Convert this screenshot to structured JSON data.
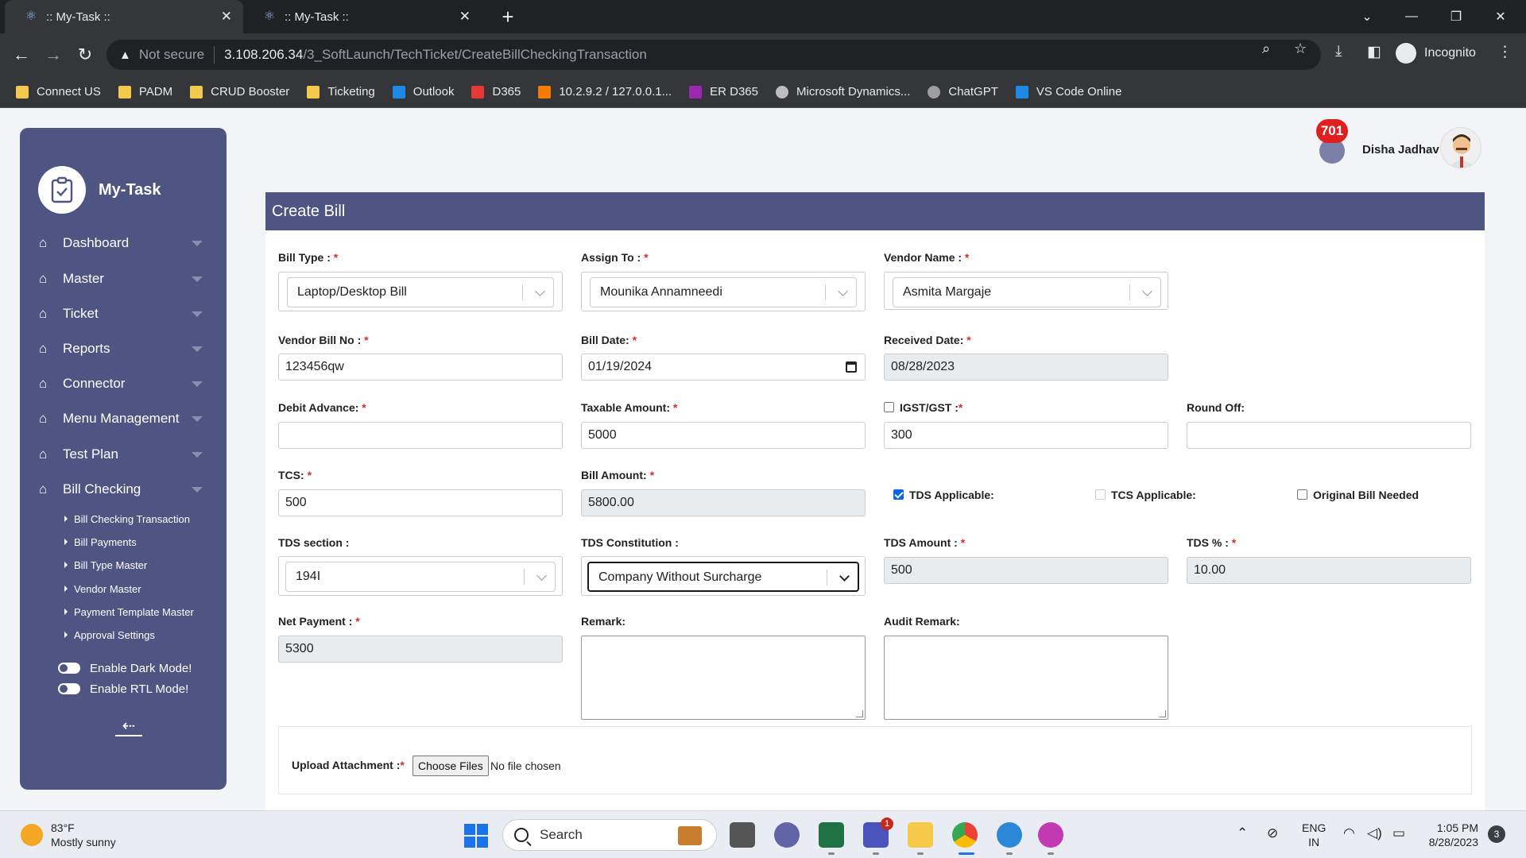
{
  "browser": {
    "tabs": [
      {
        "title": ":: My-Task ::",
        "active": true
      },
      {
        "title": ":: My-Task ::",
        "active": false
      }
    ],
    "address": {
      "security": "Not secure",
      "host": "3.108.206.34",
      "path": "/3_SoftLaunch/TechTicket/CreateBillCheckingTransaction"
    },
    "profile": "Incognito",
    "bookmarks": [
      {
        "label": "Connect US",
        "color": "#f2c94c"
      },
      {
        "label": "PADM",
        "color": "#f2c94c"
      },
      {
        "label": "CRUD Booster",
        "color": "#f2c94c"
      },
      {
        "label": "Ticketing",
        "color": "#f2c94c"
      },
      {
        "label": "Outlook",
        "color": "#1e88e5"
      },
      {
        "label": "D365",
        "color": "#e53935"
      },
      {
        "label": "10.2.9.2 / 127.0.0.1...",
        "color": "#f57c00"
      },
      {
        "label": "ER D365",
        "color": "#9c27b0"
      },
      {
        "label": "Microsoft Dynamics...",
        "color": "#bdbdbd"
      },
      {
        "label": "ChatGPT",
        "color": "#9e9e9e"
      },
      {
        "label": "VS Code Online",
        "color": "#1e88e5"
      }
    ]
  },
  "sidebar": {
    "app_name": "My-Task",
    "menu": [
      "Dashboard",
      "Master",
      "Ticket",
      "Reports",
      "Connector",
      "Menu Management",
      "Test Plan",
      "Bill Checking"
    ],
    "submenu": [
      "Bill Checking Transaction",
      "Bill Payments",
      "Bill Type Master",
      "Vendor Master",
      "Payment Template Master",
      "Approval Settings"
    ],
    "dark_mode_label": "Enable Dark Mode!",
    "rtl_mode_label": "Enable RTL Mode!"
  },
  "header": {
    "notification_count": "701",
    "user_name": "Disha Jadhav"
  },
  "form": {
    "title": "Create Bill",
    "bill_type": {
      "label": "Bill Type :",
      "value": "Laptop/Desktop Bill"
    },
    "assign_to": {
      "label": "Assign To :",
      "value": "Mounika Annamneedi"
    },
    "vendor_name": {
      "label": "Vendor Name :",
      "value": "Asmita Margaje"
    },
    "vendor_bill_no": {
      "label": "Vendor Bill No :",
      "value": "123456qw"
    },
    "bill_date": {
      "label": "Bill Date:",
      "value": "01/19/2024"
    },
    "received_date": {
      "label": "Received Date:",
      "value": "08/28/2023"
    },
    "debit_advance": {
      "label": "Debit Advance:",
      "value": ""
    },
    "taxable_amount": {
      "label": "Taxable Amount:",
      "value": "5000"
    },
    "igst_gst": {
      "label": "IGST/GST :",
      "value": "300",
      "checked": false
    },
    "round_off": {
      "label": "Round Off:",
      "value": ""
    },
    "tcs": {
      "label": "TCS:",
      "value": "500"
    },
    "bill_amount": {
      "label": "Bill Amount:",
      "value": "5800.00"
    },
    "tds_applicable": {
      "label": "TDS Applicable:",
      "checked": true
    },
    "tcs_applicable": {
      "label": "TCS Applicable:",
      "checked": false
    },
    "original_bill_needed": {
      "label": "Original Bill Needed",
      "checked": false
    },
    "tds_section": {
      "label": "TDS section :",
      "value": "194I"
    },
    "tds_constitution": {
      "label": "TDS Constitution :",
      "value": "Company Without Surcharge"
    },
    "tds_amount": {
      "label": "TDS Amount :",
      "value": "500"
    },
    "tds_percent": {
      "label": "TDS % :",
      "value": "10.00"
    },
    "net_payment": {
      "label": "Net Payment :",
      "value": "5300"
    },
    "remark": {
      "label": "Remark:",
      "value": ""
    },
    "audit_remark": {
      "label": "Audit Remark:",
      "value": ""
    },
    "upload": {
      "label": "Upload Attachment :",
      "button": "Choose Files",
      "status": "No file chosen"
    }
  },
  "taskbar": {
    "weather_temp": "83°F",
    "weather_desc": "Mostly sunny",
    "search_label": "Search",
    "lang_top": "ENG",
    "lang_bottom": "IN",
    "time": "1:05 PM",
    "date": "8/28/2023",
    "notifications": "3",
    "teams_badge": "1"
  }
}
